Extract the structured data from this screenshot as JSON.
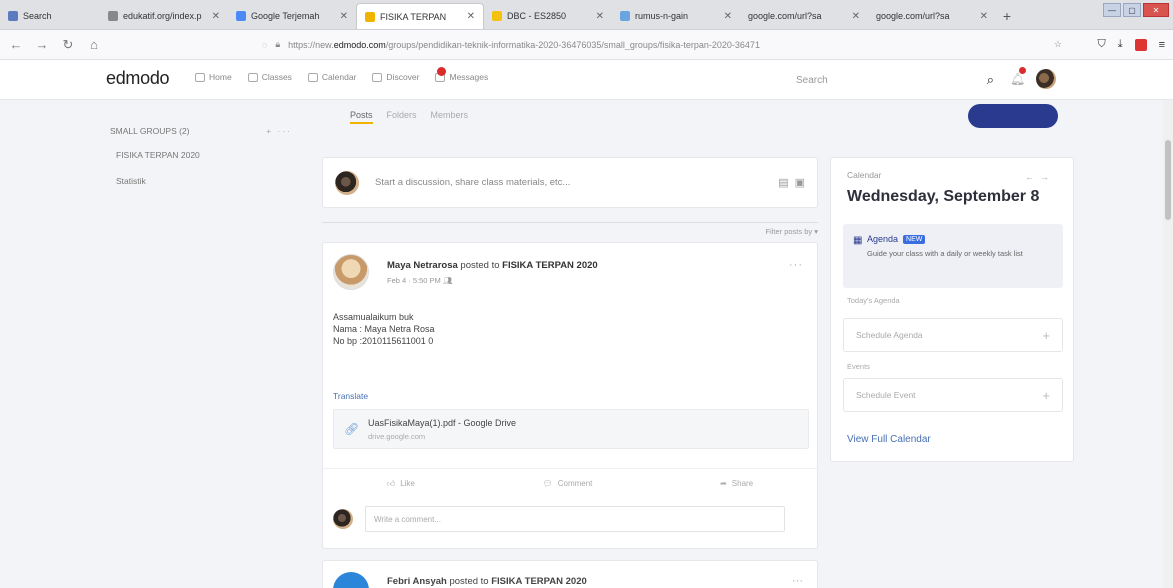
{
  "browser": {
    "tabs": [
      {
        "label": "Search",
        "color": "#5a7bbf"
      },
      {
        "label": "edukatif.org/index.p",
        "color": "#888888"
      },
      {
        "label": "Google Terjemah",
        "color": "#4a8af4"
      },
      {
        "label": "FISIKA TERPAN",
        "color": "#f0b400"
      },
      {
        "label": "DBC - ES2850",
        "color": "#f4c20d"
      },
      {
        "label": "rumus-n-gain",
        "color": "#6aa5e0"
      },
      {
        "label": "google.com/url?sa",
        "color": "#bbbbbb"
      },
      {
        "label": "google.com/url?sa",
        "color": "#bbbbbb"
      }
    ],
    "url_prefix": "https://new.",
    "url_domain": "edmodo.com",
    "url_rest": "/groups/pendidikan-teknik-informatika-2020-36476035/small_groups/fisika-terpan-2020-36471"
  },
  "app": {
    "logo": "edmodo",
    "nav": {
      "home": "Home",
      "classes": "Classes",
      "calendar": "Calendar",
      "discover": "Discover",
      "messages": "Messages"
    },
    "search_placeholder": "Search"
  },
  "sidebar": {
    "heading": "SMALL GROUPS (2)",
    "items": [
      "FISIKA TERPAN 2020",
      "Statistik"
    ]
  },
  "group_tabs": [
    "Posts",
    "Folders",
    "Members"
  ],
  "composer": {
    "placeholder": "Start a discussion, share class materials, etc..."
  },
  "filter_label": "Filter posts by",
  "post": {
    "author": "Maya Netrarosa",
    "posted_to": "posted to",
    "group": "FISIKA TERPAN 2020",
    "time": "Feb 4 · 5:50 PM",
    "lines": [
      "Assamualaikum buk",
      "Nama : Maya Netra Rosa",
      "No bp :2010115611001 0"
    ],
    "translate": "Translate",
    "attachment_name": "UasFisikaMaya(1).pdf - Google Drive",
    "attachment_url": "drive.google.com",
    "like": "Like",
    "comment": "Comment",
    "share": "Share",
    "comment_placeholder": "Write a comment..."
  },
  "post2": {
    "author": "Febri Ansyah",
    "posted_to": "posted to",
    "group": "FISIKA TERPAN 2020"
  },
  "calendar": {
    "label": "Calendar",
    "date": "Wednesday, September 8",
    "agenda_title": "Agenda",
    "agenda_badge": "NEW",
    "agenda_desc": "Guide your class with a daily or weekly task list",
    "todays_agenda": "Today's Agenda",
    "schedule_agenda": "Schedule Agenda",
    "events": "Events",
    "schedule_event": "Schedule Event",
    "view_full": "View Full Calendar"
  }
}
